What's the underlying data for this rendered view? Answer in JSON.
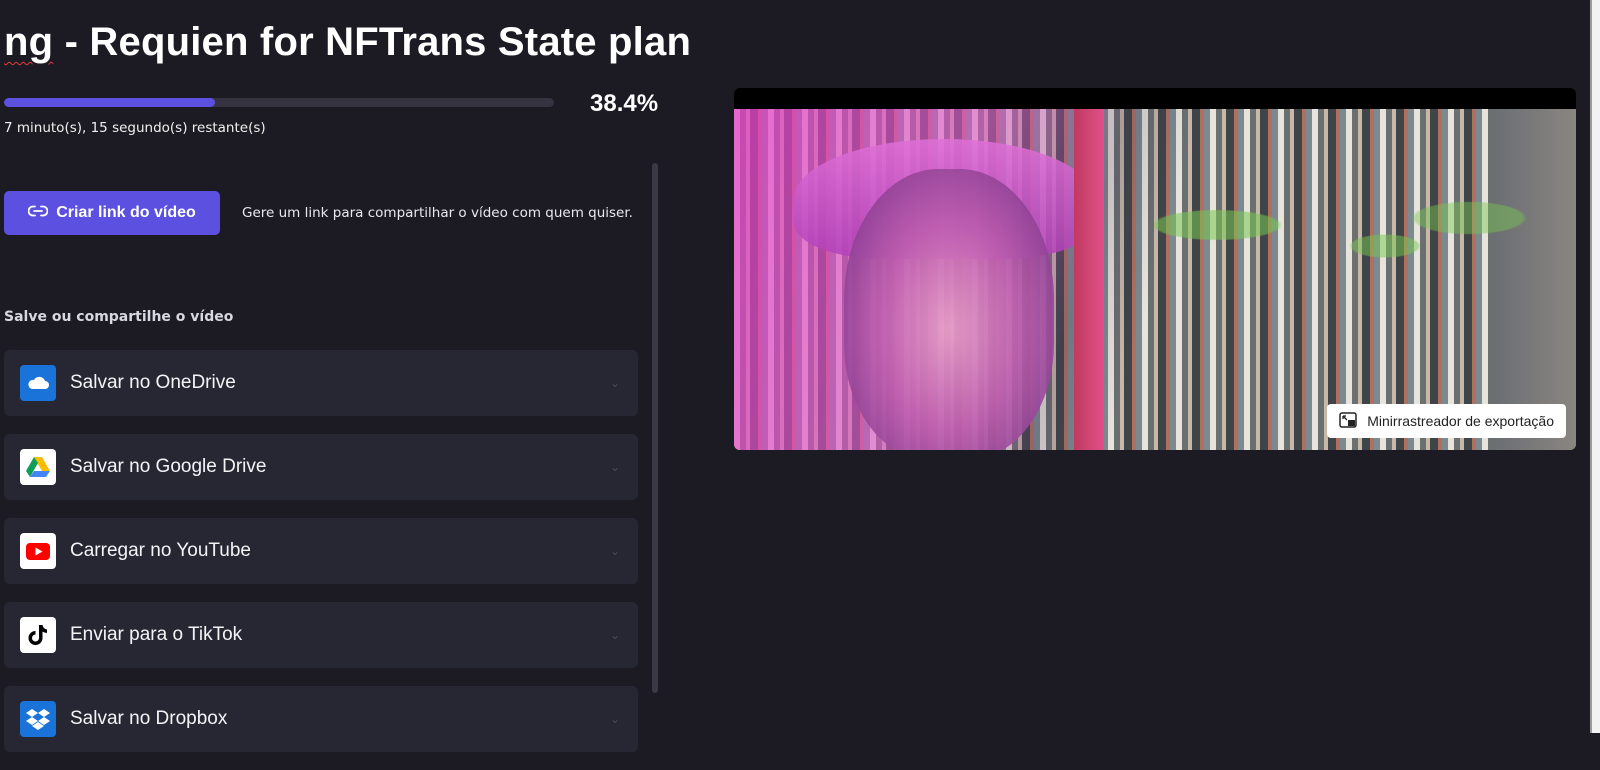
{
  "title": {
    "prefix": "ng",
    "rest": " - Requien for NFTrans State plan"
  },
  "export": {
    "progress_percent": 38.4,
    "progress_text": "38.4%",
    "remaining_text": "7 minuto(s), 15 segundo(s) restante(s)"
  },
  "link": {
    "button_label": "Criar link do vídeo",
    "description": "Gere um link para compartilhar o vídeo com quem quiser."
  },
  "share": {
    "section_label": "Salve ou compartilhe o vídeo",
    "items": [
      {
        "label": "Salvar no OneDrive",
        "icon": "onedrive-icon",
        "icon_bg": "#1a73d9"
      },
      {
        "label": "Salvar no Google Drive",
        "icon": "google-drive-icon",
        "icon_bg": "#ffffff"
      },
      {
        "label": "Carregar no YouTube",
        "icon": "youtube-icon",
        "icon_bg": "#ffffff"
      },
      {
        "label": "Enviar para o TikTok",
        "icon": "tiktok-icon",
        "icon_bg": "#ffffff"
      },
      {
        "label": "Salvar no Dropbox",
        "icon": "dropbox-icon",
        "icon_bg": "#1a73d9"
      }
    ]
  },
  "preview": {
    "mini_tracker_label": "Minirrastreador de exportação"
  },
  "colors": {
    "accent": "#5b50e0",
    "background": "#1c1b24",
    "card": "#272734"
  }
}
